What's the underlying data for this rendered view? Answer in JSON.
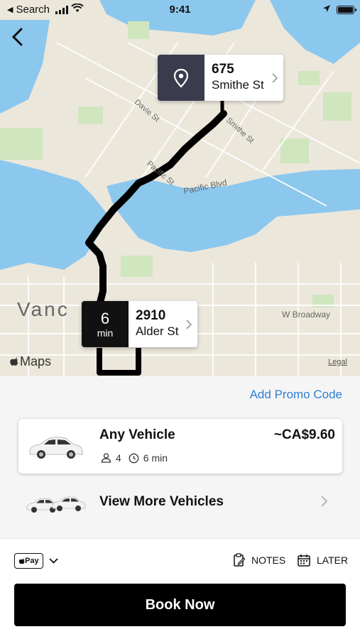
{
  "status_bar": {
    "back_app": "Search",
    "time": "9:41"
  },
  "map": {
    "labels": {
      "davie": "Davie St",
      "pacific_st": "Pacific St",
      "pacific_blvd": "Pacific Blvd",
      "smithe": "Smithe St",
      "vancouver": "Vanc",
      "broadway": "W Broadway"
    },
    "destination": {
      "number": "675",
      "street": "Smithe St"
    },
    "origin": {
      "eta": "6",
      "eta_unit": "min",
      "number": "2910",
      "street": "Alder St"
    },
    "attribution": "Maps",
    "legal": "Legal"
  },
  "sheet": {
    "promo_label": "Add Promo Code",
    "vehicle": {
      "name": "Any Vehicle",
      "price": "~CA$9.60",
      "seats": "4",
      "eta": "6 min"
    },
    "more_vehicles_label": "View More Vehicles",
    "payment": {
      "method": "Pay"
    },
    "notes_label": "NOTES",
    "later_label": "LATER",
    "book_label": "Book Now"
  },
  "colors": {
    "accent": "#2f7fd1",
    "callout_dark": "#3a3b4d",
    "route": "#000000"
  }
}
